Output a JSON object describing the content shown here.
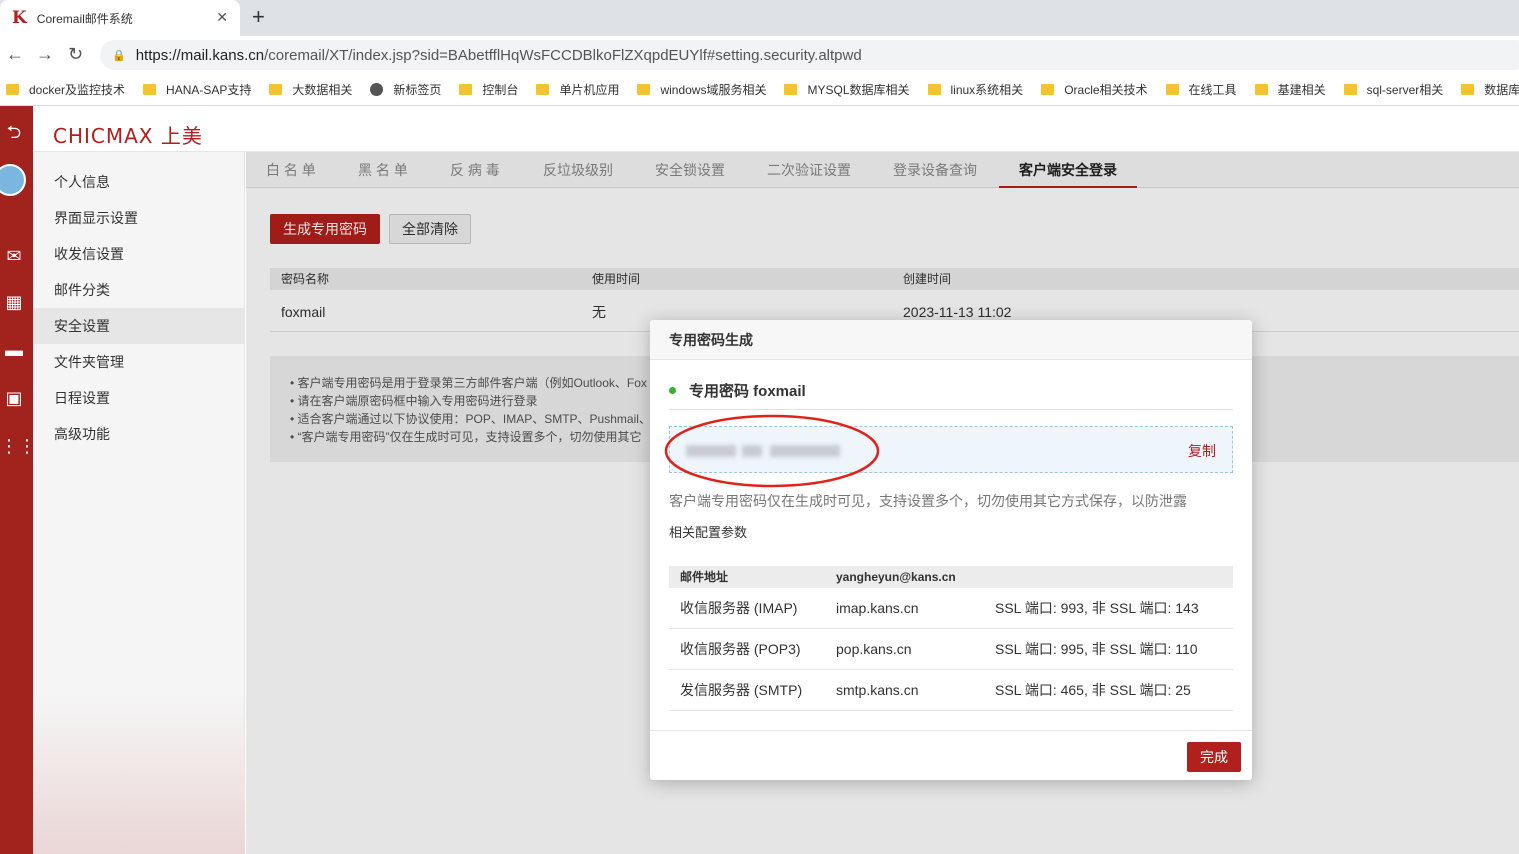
{
  "browser": {
    "tab_title": "Coremail邮件系统",
    "tab_favicon": "K",
    "url_host": "https://mail.kans.cn",
    "url_path": "/coremail/XT/index.jsp?sid=BAbetfflHqWsFCCDBlkoFlZXqpdEUYlf#setting.security.altpwd",
    "bookmarks": [
      "docker及监控技术",
      "HANA-SAP支持",
      "大数据相关",
      "新标签页",
      "控制台",
      "单片机应用",
      "windows域服务相关",
      "MYSQL数据库相关",
      "linux系统相关",
      "Oracle相关技术",
      "在线工具",
      "基建相关",
      "sql-server相关",
      "数据库"
    ]
  },
  "app": {
    "logo": "CHICMAX 上美",
    "sidebar": [
      "个人信息",
      "界面显示设置",
      "收发信设置",
      "邮件分类",
      "安全设置",
      "文件夹管理",
      "日程设置",
      "高级功能"
    ],
    "sidebar_active_index": 4,
    "tabs": [
      "白 名 单",
      "黑 名 单",
      "反 病 毒",
      "反垃圾级别",
      "安全锁设置",
      "二次验证设置",
      "登录设备查询",
      "客户端安全登录"
    ],
    "buttons": {
      "generate": "生成专用密码",
      "clear_all": "全部清除"
    },
    "table": {
      "headers": [
        "密码名称",
        "使用时间",
        "创建时间"
      ],
      "rows": [
        [
          "foxmail",
          "无",
          "2023-11-13 11:02"
        ]
      ]
    },
    "notes": [
      "• 客户端专用密码是用于登录第三方邮件客户端（例如Outlook、Fox",
      "• 请在客户端原密码框中输入专用密码进行登录",
      "• 适合客户端通过以下协议使用：POP、IMAP、SMTP、Pushmail、",
      "• “客户端专用密码”仅在生成时可见，支持设置多个，切勿使用其它"
    ]
  },
  "modal": {
    "title": "专用密码生成",
    "password_label": "专用密码 foxmail",
    "copy": "复制",
    "tip": "客户端专用密码仅在生成时可见，支持设置多个，切勿使用其它方式保存，以防泄露",
    "config_title": "相关配置参数",
    "config_head": {
      "label": "邮件地址",
      "value": "yangheyun@kans.cn"
    },
    "config_rows": [
      {
        "label": "收信服务器 (IMAP)",
        "host": "imap.kans.cn",
        "ports": "SSL 端口: 993, 非 SSL 端口: 143"
      },
      {
        "label": "收信服务器 (POP3)",
        "host": "pop.kans.cn",
        "ports": "SSL 端口: 995, 非 SSL 端口: 110"
      },
      {
        "label": "发信服务器 (SMTP)",
        "host": "smtp.kans.cn",
        "ports": "SSL 端口: 465, 非 SSL 端口: 25"
      }
    ],
    "done": "完成"
  },
  "colors": {
    "brand_red": "#b1201c",
    "success_dot": "#34b233"
  }
}
